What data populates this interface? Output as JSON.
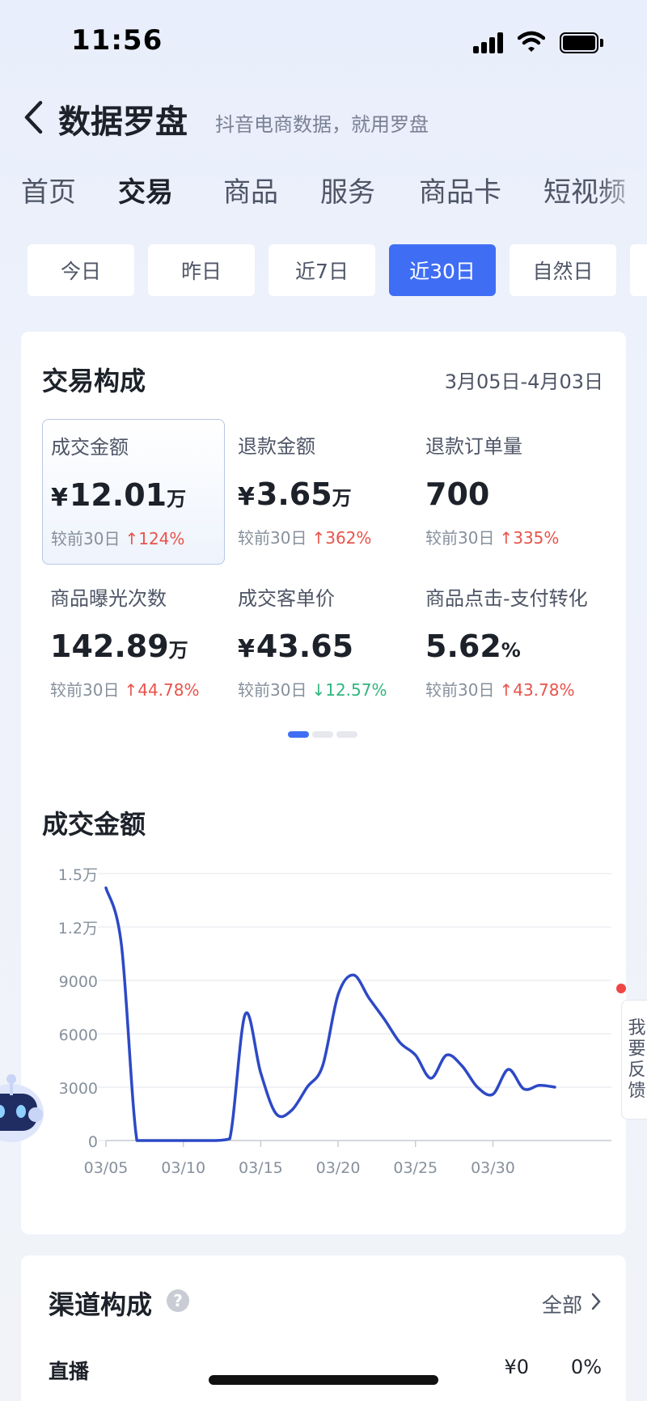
{
  "status_bar": {
    "time": "11:56"
  },
  "header": {
    "title": "数据罗盘",
    "subtitle": "抖音电商数据，就用罗盘"
  },
  "main_tabs": [
    {
      "label": "首页",
      "active": false
    },
    {
      "label": "交易",
      "active": true
    },
    {
      "label": "商品",
      "active": false
    },
    {
      "label": "服务",
      "active": false
    },
    {
      "label": "商品卡",
      "active": false
    },
    {
      "label": "短视频",
      "active": false
    }
  ],
  "date_tabs": [
    {
      "label": "今日",
      "active": false
    },
    {
      "label": "昨日",
      "active": false
    },
    {
      "label": "近7日",
      "active": false
    },
    {
      "label": "近30日",
      "active": true
    },
    {
      "label": "自然日",
      "active": false
    }
  ],
  "composition": {
    "title": "交易构成",
    "range": "3月05日-4月03日",
    "metrics": [
      {
        "label": "成交金额",
        "prefix": "¥",
        "value": "12.01",
        "unit": "万",
        "compare_label": "较前30日",
        "change": "124%",
        "direction": "up",
        "selected": true
      },
      {
        "label": "退款金额",
        "prefix": "¥",
        "value": "3.65",
        "unit": "万",
        "compare_label": "较前30日",
        "change": "362%",
        "direction": "up",
        "selected": false
      },
      {
        "label": "退款订单量",
        "prefix": "",
        "value": "700",
        "unit": "",
        "compare_label": "较前30日",
        "change": "335%",
        "direction": "up",
        "selected": false
      },
      {
        "label": "商品曝光次数",
        "prefix": "",
        "value": "142.89",
        "unit": "万",
        "compare_label": "较前30日",
        "change": "44.78%",
        "direction": "up",
        "selected": false
      },
      {
        "label": "成交客单价",
        "prefix": "¥",
        "value": "43.65",
        "unit": "",
        "compare_label": "较前30日",
        "change": "12.57%",
        "direction": "down",
        "selected": false
      },
      {
        "label": "商品点击-支付转化",
        "prefix": "",
        "value": "5.62",
        "unit": "%",
        "compare_label": "较前30日",
        "change": "43.78%",
        "direction": "up",
        "selected": false
      }
    ],
    "pager": {
      "pages": 3,
      "current": 1
    }
  },
  "chart_title": "成交金额",
  "chart_data": {
    "type": "line",
    "title": "成交金额",
    "xlabel": "",
    "ylabel": "",
    "x_tick_labels": [
      "03/05",
      "03/10",
      "03/15",
      "03/20",
      "03/25",
      "03/30"
    ],
    "y_tick_labels": [
      "0",
      "3000",
      "6000",
      "9000",
      "1.2万",
      "1.5万"
    ],
    "y_ticks": [
      0,
      3000,
      6000,
      9000,
      12000,
      15000
    ],
    "ylim": [
      0,
      15000
    ],
    "grid": true,
    "series": [
      {
        "color": "#2d49c6",
        "x": [
          "03/05",
          "03/06",
          "03/07",
          "03/08",
          "03/09",
          "03/10",
          "03/11",
          "03/12",
          "03/13",
          "03/14",
          "03/15",
          "03/16",
          "03/17",
          "03/18",
          "03/19",
          "03/20",
          "03/21",
          "03/22",
          "03/23",
          "03/24",
          "03/25",
          "03/26",
          "03/27",
          "03/28",
          "03/29",
          "03/30",
          "03/31",
          "04/01",
          "04/02",
          "04/03"
        ],
        "values": [
          14200,
          11000,
          0,
          0,
          0,
          0,
          0,
          0,
          100,
          7100,
          3800,
          1500,
          1700,
          3000,
          4200,
          8200,
          9300,
          8000,
          6800,
          5500,
          4800,
          3500,
          4800,
          4200,
          3000,
          2600,
          4000,
          2900,
          3100,
          3000
        ]
      }
    ]
  },
  "channels": {
    "title": "渠道构成",
    "help_icon": "question-icon",
    "filter": "全部",
    "rows": [
      {
        "label": "直播",
        "amount": "¥0",
        "percent": "0%"
      }
    ]
  },
  "feedback": {
    "label": "我要反馈"
  },
  "colors": {
    "accent": "#3f6ef5",
    "up": "#e8534a",
    "down": "#2fb57d",
    "line": "#2d49c6"
  }
}
